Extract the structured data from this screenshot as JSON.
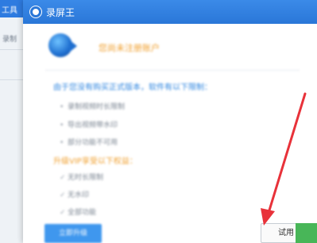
{
  "background_app": {
    "toolbar_label": "工具",
    "nav_item": "录制"
  },
  "dialog": {
    "title": "录屏王",
    "headline": "您尚未注册账户",
    "section1_title": "由于您没有购买正式版本，软件有以下限制：",
    "section1_items": [
      "录制视频时长限制",
      "导出视频带水印",
      "部分功能不可用"
    ],
    "section2_title": "升级VIP享受以下权益：",
    "section2_items": [
      "无时长限制",
      "无水印",
      "全部功能"
    ],
    "buy_button": "立即升级",
    "trial_button": "试用"
  },
  "annotation": {
    "arrow_color": "#e8323a"
  }
}
